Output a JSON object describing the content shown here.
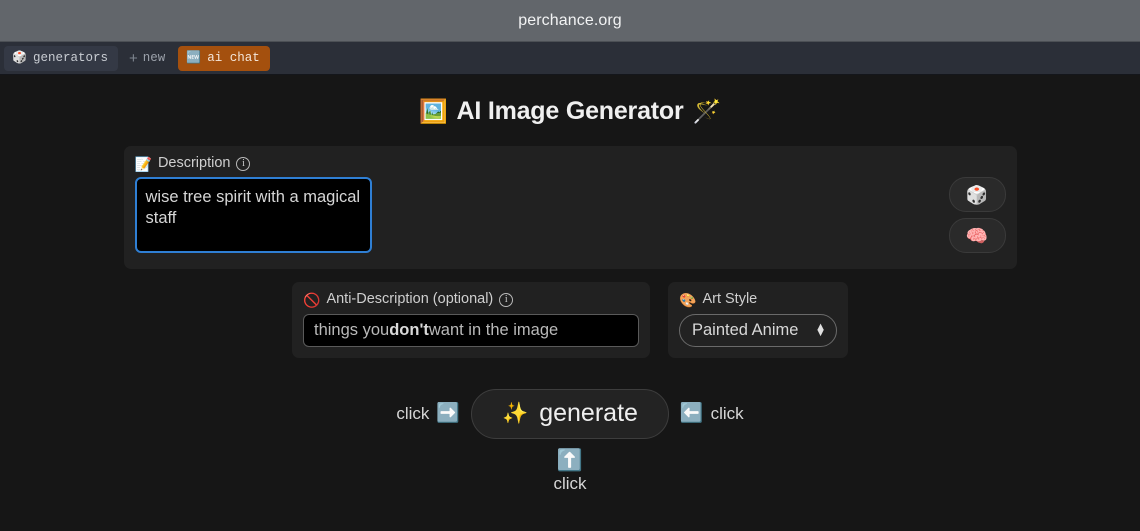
{
  "browser": {
    "title": "perchance.org",
    "tabs": [
      {
        "label": "generators",
        "icon": "dice-icon",
        "emoji": "🎲",
        "state": "active"
      },
      {
        "label": "new",
        "icon": "plus-icon",
        "emoji": "+",
        "state": "inactive"
      },
      {
        "label": "ai chat",
        "icon": "new-badge-icon",
        "emoji": "🆕",
        "state": "highlighted"
      }
    ]
  },
  "page": {
    "title": "AI Image Generator",
    "title_left_emoji": "🖼️",
    "title_right_emoji": "🪄",
    "description": {
      "label": "Description",
      "label_emoji": "📝",
      "info_glyph": "i",
      "value": "wise tree spirit with a magical staff",
      "placeholder": "",
      "randomize_emoji": "🎲",
      "brain_emoji": "🧠"
    },
    "anti_description": {
      "label": "Anti-Description (optional)",
      "label_emoji": "🚫",
      "info_glyph": "i",
      "value": "",
      "placeholder_part1": "things you ",
      "placeholder_bold": "don't",
      "placeholder_part2": " want in the image"
    },
    "art_style": {
      "label": "Art Style",
      "label_emoji": "🎨",
      "selected": "Painted Anime"
    },
    "generate": {
      "left_hint": "click",
      "left_arrow_emoji": "➡️",
      "button_label": "generate",
      "button_emoji": "✨",
      "right_arrow_emoji": "⬅️",
      "right_hint": "click",
      "below_arrow_emoji": "⬆️",
      "below_hint": "click"
    }
  },
  "colors": {
    "titlebar": "#62666b",
    "tabstrip": "#2b2f38",
    "tab_highlight": "#a4500e",
    "page_bg": "#161616",
    "panel_bg": "#212121",
    "focus_border": "#2f7fd4",
    "input_bg": "#000000"
  }
}
